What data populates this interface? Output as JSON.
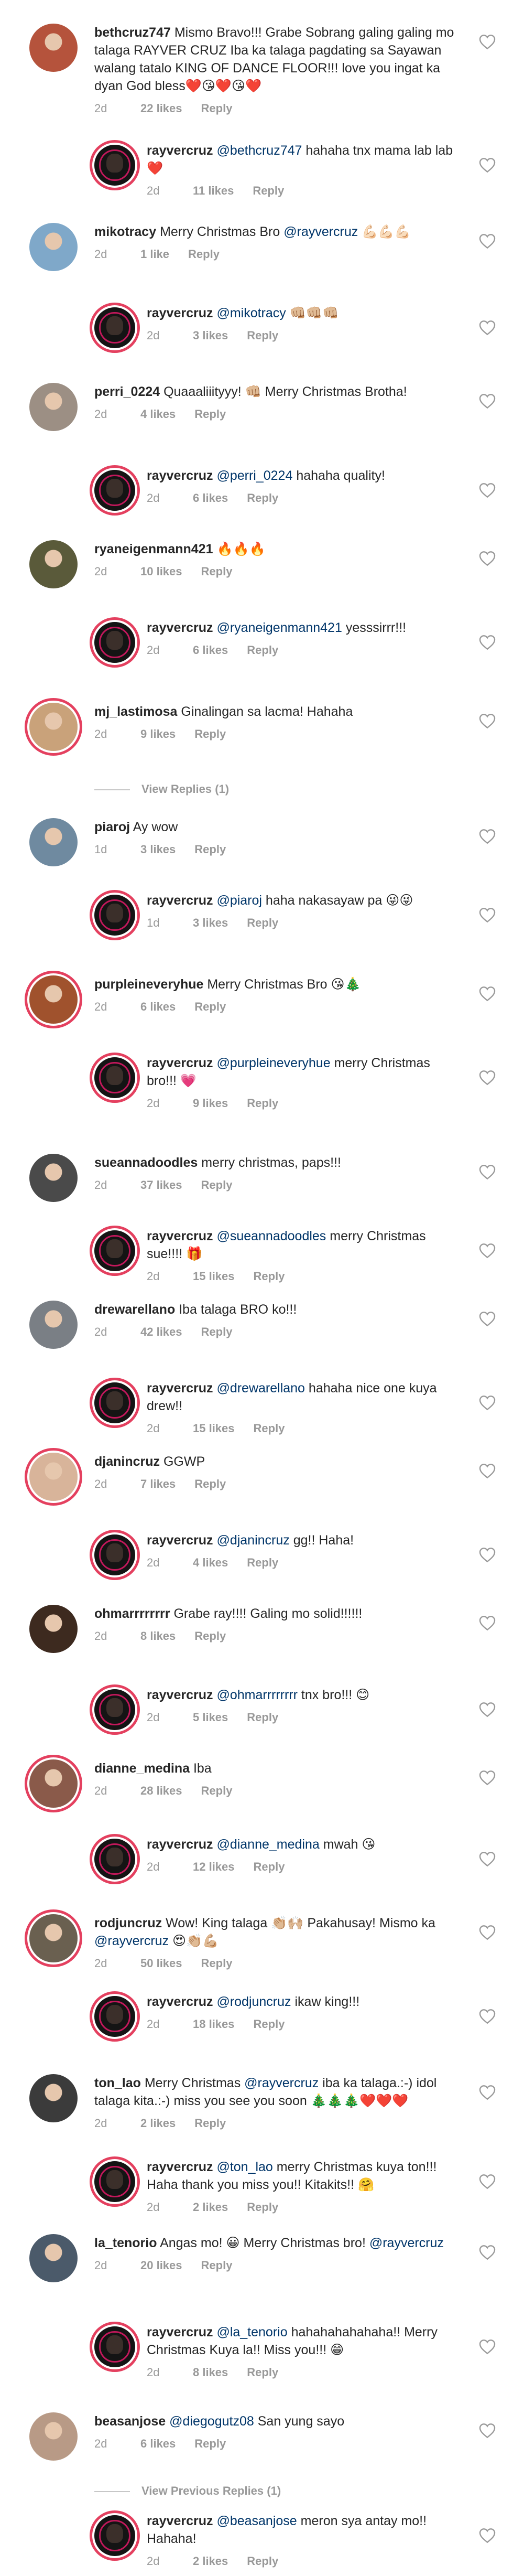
{
  "labels": {
    "reply": "Reply"
  },
  "comments": [
    {
      "username": "bethcruz747",
      "text": "Mismo Bravo!!! Grabe Sobrang galing galing mo talaga RAYVER CRUZ Iba ka talaga pagdating sa Sayawan walang tatalo KING OF DANCE FLOOR!!! love you ingat ka dyan God bless❤️😘❤️😘❤️",
      "time": "2d",
      "likes": "22 likes",
      "avatar_color": "#b5533c",
      "story": false
    },
    {
      "username": "rayvercruz",
      "mention": "@bethcruz747",
      "text": "hahaha tnx mama lab lab ❤️",
      "time": "2d",
      "likes": "11 likes",
      "reply": true
    },
    {
      "username": "mikotracy",
      "text": "Merry Christmas Bro",
      "mention_after": "@rayvercruz",
      "suffix": "💪🏻💪🏻💪🏻",
      "time": "2d",
      "likes": "1 like",
      "avatar_color": "#7fa8c9",
      "story": false
    },
    {
      "username": "rayvercruz",
      "mention": "@mikotracy",
      "text": "👊🏼👊🏼👊🏼",
      "time": "2d",
      "likes": "3 likes",
      "reply": true
    },
    {
      "username": "perri_0224",
      "text": "Quaaaliiityyy! 👊🏼 Merry Christmas Brotha!",
      "time": "2d",
      "likes": "4 likes",
      "avatar_color": "#9c8f84",
      "story": false
    },
    {
      "username": "rayvercruz",
      "mention": "@perri_0224",
      "text": "hahaha quality!",
      "time": "2d",
      "likes": "6 likes",
      "reply": true
    },
    {
      "username": "ryaneigenmann421",
      "text": "🔥🔥🔥",
      "time": "2d",
      "likes": "10 likes",
      "avatar_color": "#5a5a3a",
      "story": false
    },
    {
      "username": "rayvercruz",
      "mention": "@ryaneigenmann421",
      "text": "yesssirrr!!!",
      "time": "2d",
      "likes": "6 likes",
      "reply": true
    },
    {
      "username": "mj_lastimosa",
      "text": "Ginalingan sa lacma! Hahaha",
      "time": "2d",
      "likes": "9 likes",
      "avatar_color": "#c9a27a",
      "story": true
    },
    {
      "username": "piaroj",
      "text": "Ay wow",
      "time": "1d",
      "likes": "3 likes",
      "avatar_color": "#6f8aa0",
      "story": false
    },
    {
      "username": "rayvercruz",
      "mention": "@piaroj",
      "text": "haha nakasayaw pa 😜😜",
      "time": "1d",
      "likes": "3 likes",
      "reply": true
    },
    {
      "username": "purpleineveryhue",
      "text": "Merry Christmas Bro 😘🎄",
      "time": "2d",
      "likes": "6 likes",
      "avatar_color": "#a0522d",
      "story": true
    },
    {
      "username": "rayvercruz",
      "mention": "@purpleineveryhue",
      "text": "merry Christmas bro!!! 💗",
      "time": "2d",
      "likes": "9 likes",
      "reply": true
    },
    {
      "username": "sueannadoodles",
      "text": "merry christmas, paps!!!",
      "time": "2d",
      "likes": "37 likes",
      "avatar_color": "#4a4a4a",
      "story": false
    },
    {
      "username": "rayvercruz",
      "mention": "@sueannadoodles",
      "text": "merry Christmas sue!!!! 🎁",
      "time": "2d",
      "likes": "15 likes",
      "reply": true
    },
    {
      "username": "drewarellano",
      "text": "Iba talaga BRO ko!!!",
      "time": "2d",
      "likes": "42 likes",
      "avatar_color": "#7a7f85",
      "story": false
    },
    {
      "username": "rayvercruz",
      "mention": "@drewarellano",
      "text": "hahaha nice one kuya drew!!",
      "time": "2d",
      "likes": "15 likes",
      "reply": true
    },
    {
      "username": "djanincruz",
      "text": "GGWP",
      "time": "2d",
      "likes": "7 likes",
      "avatar_color": "#d8b49a",
      "story": true
    },
    {
      "username": "rayvercruz",
      "mention": "@djanincruz",
      "text": "gg!! Haha!",
      "time": "2d",
      "likes": "4 likes",
      "reply": true
    },
    {
      "username": "ohmarrrrrrrr",
      "text": "Grabe ray!!!! Galing mo solid!!!!!!",
      "time": "2d",
      "likes": "8 likes",
      "avatar_color": "#3d2a1f",
      "story": false
    },
    {
      "username": "rayvercruz",
      "mention": "@ohmarrrrrrrr",
      "text": "tnx bro!!! 😊",
      "time": "2d",
      "likes": "5 likes",
      "reply": true
    },
    {
      "username": "dianne_medina",
      "text": "Iba",
      "time": "2d",
      "likes": "28 likes",
      "avatar_color": "#8a5a4a",
      "story": true
    },
    {
      "username": "rayvercruz",
      "mention": "@dianne_medina",
      "text": "mwah 😘",
      "time": "2d",
      "likes": "12 likes",
      "reply": true
    },
    {
      "username": "rodjuncruz",
      "text": "Wow! King talaga 👏🏼🙌🏼 Pakahusay! Mismo ka",
      "mention_after": "@rayvercruz",
      "suffix": "😍👏🏼💪🏼",
      "time": "2d",
      "likes": "50 likes",
      "avatar_color": "#6a6050",
      "story": true
    },
    {
      "username": "rayvercruz",
      "mention": "@rodjuncruz",
      "text": "ikaw king!!!",
      "time": "2d",
      "likes": "18 likes",
      "reply": true
    },
    {
      "username": "ton_lao",
      "text": "Merry Christmas",
      "mention_after": "@rayvercruz",
      "suffix": "iba ka talaga.:-) idol talaga kita.:-) miss you see you soon 🎄🎄🎄❤️❤️❤️",
      "time": "2d",
      "likes": "2 likes",
      "avatar_color": "#3b3b3b",
      "story": false
    },
    {
      "username": "rayvercruz",
      "mention": "@ton_lao",
      "text": "merry Christmas kuya ton!!! Haha thank you miss you!! Kitakits!! 🤗",
      "time": "2d",
      "likes": "2 likes",
      "reply": true
    },
    {
      "username": "la_tenorio",
      "text": "Angas mo! 😀 Merry Christmas bro!",
      "mention_after": "@rayvercruz",
      "suffix": "",
      "time": "2d",
      "likes": "20 likes",
      "avatar_color": "#4b5a6a",
      "story": false
    },
    {
      "username": "rayvercruz",
      "mention": "@la_tenorio",
      "text": "hahahahahahaha!! Merry Christmas Kuya la!! Miss you!!! 😁",
      "time": "2d",
      "likes": "8 likes",
      "reply": true
    },
    {
      "username": "beasanjose",
      "mention": "@diegogutz08",
      "text": "San yung sayo",
      "time": "2d",
      "likes": "6 likes",
      "avatar_color": "#b89a86",
      "story": false
    },
    {
      "username": "rayvercruz",
      "mention": "@beasanjose",
      "text": "meron sya antay mo!! Hahaha!",
      "time": "2d",
      "likes": "2 likes",
      "reply": true
    }
  ],
  "view_replies": [
    {
      "label": "View Replies (1)"
    },
    {
      "label": "View Previous Replies (1)"
    }
  ]
}
